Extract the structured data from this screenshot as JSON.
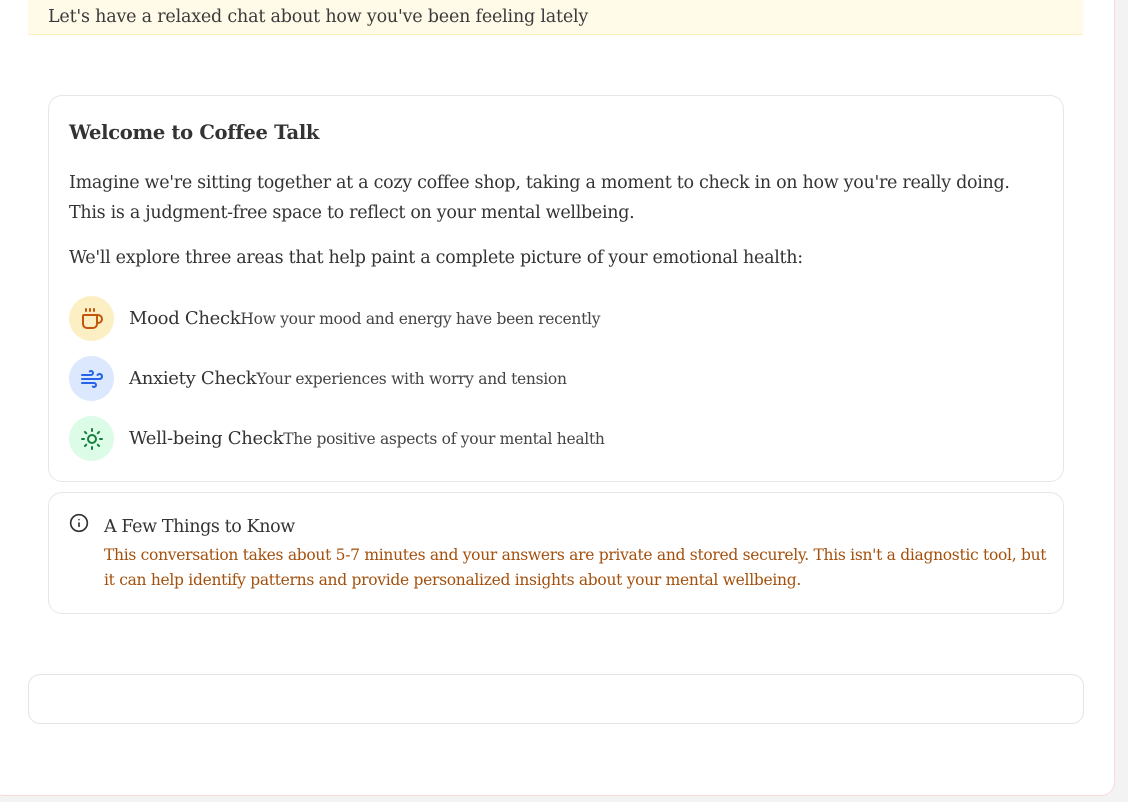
{
  "banner": {
    "text": "Let's have a relaxed chat about how you've been feeling lately"
  },
  "welcome": {
    "title": "Welcome to Coffee Talk",
    "intro": "Imagine we're sitting together at a cozy coffee shop, taking a moment to check in on how you're really doing. This is a judgment-free space to reflect on your mental wellbeing.",
    "areas_intro": "We'll explore three areas that help paint a complete picture of your emotional health:",
    "areas": [
      {
        "name": "Mood Check",
        "description": "How your mood and energy have been recently",
        "icon": "coffee-cup-icon",
        "bg": "#fdefc4",
        "color": "#c2570c"
      },
      {
        "name": "Anxiety Check",
        "description": "Your experiences with worry and tension",
        "icon": "wind-icon",
        "bg": "#dbe8fe",
        "color": "#2563eb"
      },
      {
        "name": "Well-being Check",
        "description": "The positive aspects of your mental health",
        "icon": "sun-icon",
        "bg": "#dcfce7",
        "color": "#15803d"
      }
    ]
  },
  "info": {
    "icon": "info-icon",
    "title": "A Few Things to Know",
    "text": "This conversation takes about 5-7 minutes and your answers are private and stored securely. This isn't a diagnostic tool, but it can help identify patterns and provide personalized insights about your mental wellbeing."
  }
}
